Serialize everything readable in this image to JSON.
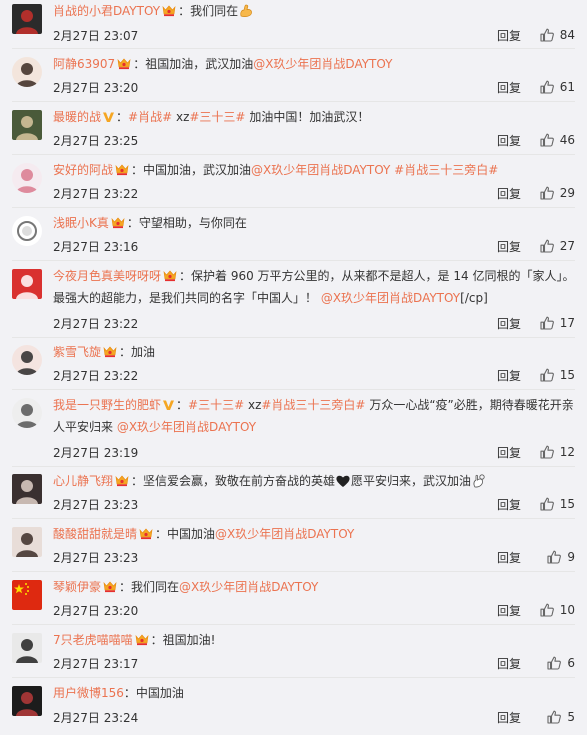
{
  "reply_label": "回复",
  "comments": [
    {
      "user": "肖战的小君DAYTOY",
      "badge": "vip",
      "parts": [
        {
          "t": "plain",
          "v": "：我们同在"
        },
        {
          "t": "emoji",
          "v": "muscle"
        }
      ],
      "time": "2月27日 23:07",
      "likes": "84"
    },
    {
      "user": "阿静63907",
      "badge": "vip",
      "parts": [
        {
          "t": "plain",
          "v": "：祖国加油，武汉加油"
        },
        {
          "t": "mention",
          "v": "@X玖少年团肖战DAYTOY"
        }
      ],
      "time": "2月27日 23:20",
      "likes": "61"
    },
    {
      "user": "最暖的战",
      "badge": "v",
      "parts": [
        {
          "t": "plain",
          "v": "："
        },
        {
          "t": "tag",
          "v": "#肖战#"
        },
        {
          "t": "plain",
          "v": " xz"
        },
        {
          "t": "tag",
          "v": "#三十三#"
        },
        {
          "t": "plain",
          "v": " 加油中国！加油武汉！"
        }
      ],
      "time": "2月27日 23:25",
      "likes": "46"
    },
    {
      "user": "安好的阿战",
      "badge": "vip",
      "parts": [
        {
          "t": "plain",
          "v": "：中国加油，武汉加油"
        },
        {
          "t": "mention",
          "v": "@X玖少年团肖战DAYTOY"
        },
        {
          "t": "plain",
          "v": " "
        },
        {
          "t": "tag",
          "v": "#肖战三十三旁白#"
        }
      ],
      "time": "2月27日 23:22",
      "likes": "29"
    },
    {
      "user": "浅眠小K真",
      "badge": "vip",
      "parts": [
        {
          "t": "plain",
          "v": "：守望相助，与你同在"
        }
      ],
      "time": "2月27日 23:16",
      "likes": "27"
    },
    {
      "user": "今夜月色真美呀呀呀",
      "badge": "vip",
      "parts": [
        {
          "t": "plain",
          "v": "：保护着 960 万平方公里的，从来都不是超人，是 14 亿同根的「家人」。最强大的超能力，是我们共同的名字「中国人」！ "
        },
        {
          "t": "mention",
          "v": "@X玖少年团肖战DAYTOY"
        },
        {
          "t": "plain",
          "v": "[/cp]"
        }
      ],
      "time": "2月27日 23:22",
      "likes": "17"
    },
    {
      "user": "紫雪飞旋",
      "badge": "vip",
      "parts": [
        {
          "t": "plain",
          "v": "：加油"
        }
      ],
      "time": "2月27日 23:22",
      "likes": "15"
    },
    {
      "user": "我是一只野生的肥虾",
      "badge": "v",
      "parts": [
        {
          "t": "plain",
          "v": "："
        },
        {
          "t": "tag",
          "v": "#三十三#"
        },
        {
          "t": "plain",
          "v": " xz"
        },
        {
          "t": "tag",
          "v": "#肖战三十三旁白#"
        },
        {
          "t": "plain",
          "v": " 万众一心战“疫”必胜，期待春暖花开亲人平安归来 "
        },
        {
          "t": "mention",
          "v": "@X玖少年团肖战DAYTOY"
        }
      ],
      "time": "2月27日 23:19",
      "likes": "12"
    },
    {
      "user": "心儿静飞翔",
      "badge": "vip",
      "parts": [
        {
          "t": "plain",
          "v": "：坚信爱会赢，致敬在前方奋战的英雄"
        },
        {
          "t": "emoji",
          "v": "heart"
        },
        {
          "t": "plain",
          "v": "愿平安归来，武汉加油"
        },
        {
          "t": "emoji",
          "v": "ok"
        }
      ],
      "time": "2月27日 23:23",
      "likes": "15"
    },
    {
      "user": "酸酸甜甜就是晴",
      "badge": "vip",
      "parts": [
        {
          "t": "plain",
          "v": "：中国加油"
        },
        {
          "t": "mention",
          "v": "@X玖少年团肖战DAYTOY"
        }
      ],
      "time": "2月27日 23:23",
      "likes": "9"
    },
    {
      "user": "琴颖伊豪",
      "badge": "vip",
      "parts": [
        {
          "t": "plain",
          "v": "：我们同在"
        },
        {
          "t": "mention",
          "v": "@X玖少年团肖战DAYTOY"
        }
      ],
      "time": "2月27日 23:20",
      "likes": "10"
    },
    {
      "user": "7只老虎喵喵喵",
      "badge": "vip",
      "parts": [
        {
          "t": "plain",
          "v": "：祖国加油!"
        }
      ],
      "time": "2月27日 23:17",
      "likes": "6"
    },
    {
      "user": "用户微博156",
      "badge": "none",
      "parts": [
        {
          "t": "plain",
          "v": "：中国加油"
        }
      ],
      "time": "2月27日 23:24",
      "likes": "5"
    }
  ]
}
